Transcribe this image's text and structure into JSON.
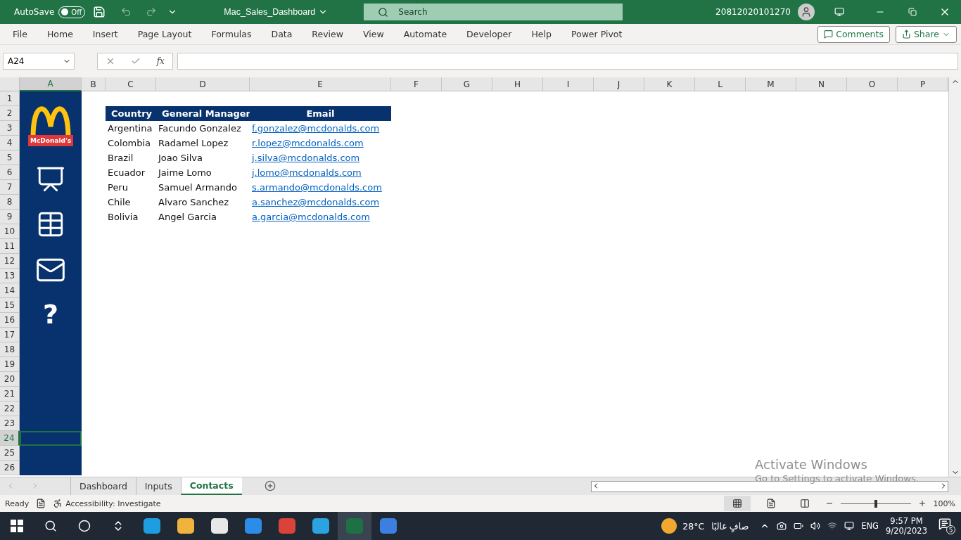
{
  "title_bar": {
    "autosave_label": "AutoSave",
    "autosave_state": "Off",
    "autosave_on": false,
    "document_title": "Mac_Sales_Dashboard",
    "search_placeholder": "Search",
    "user": "20812020101270"
  },
  "ribbon_tabs": [
    "File",
    "Home",
    "Insert",
    "Page Layout",
    "Formulas",
    "Data",
    "Review",
    "View",
    "Automate",
    "Developer",
    "Help",
    "Power Pivot"
  ],
  "comments_button": "Comments",
  "share_button": "Share",
  "formula_bar": {
    "name_box": "A24",
    "function_label": "fx"
  },
  "columns": [
    {
      "label": "A",
      "selected": true
    },
    {
      "label": "B",
      "selected": false
    },
    {
      "label": "C",
      "selected": false
    },
    {
      "label": "D",
      "selected": false
    },
    {
      "label": "E",
      "selected": false
    },
    {
      "label": "F",
      "selected": false
    },
    {
      "label": "G",
      "selected": false
    },
    {
      "label": "H",
      "selected": false
    },
    {
      "label": "I",
      "selected": false
    },
    {
      "label": "J",
      "selected": false
    },
    {
      "label": "K",
      "selected": false
    },
    {
      "label": "L",
      "selected": false
    },
    {
      "label": "M",
      "selected": false
    },
    {
      "label": "N",
      "selected": false
    },
    {
      "label": "O",
      "selected": false
    },
    {
      "label": "P",
      "selected": false
    }
  ],
  "rows": [
    {
      "label": "1",
      "selected": false
    },
    {
      "label": "2",
      "selected": false
    },
    {
      "label": "3",
      "selected": false
    },
    {
      "label": "4",
      "selected": false
    },
    {
      "label": "5",
      "selected": false
    },
    {
      "label": "6",
      "selected": false
    },
    {
      "label": "7",
      "selected": false
    },
    {
      "label": "8",
      "selected": false
    },
    {
      "label": "9",
      "selected": false
    },
    {
      "label": "10",
      "selected": false
    },
    {
      "label": "11",
      "selected": false
    },
    {
      "label": "12",
      "selected": false
    },
    {
      "label": "13",
      "selected": false
    },
    {
      "label": "14",
      "selected": false
    },
    {
      "label": "15",
      "selected": false
    },
    {
      "label": "16",
      "selected": false
    },
    {
      "label": "17",
      "selected": false
    },
    {
      "label": "18",
      "selected": false
    },
    {
      "label": "19",
      "selected": false
    },
    {
      "label": "20",
      "selected": false
    },
    {
      "label": "21",
      "selected": false
    },
    {
      "label": "22",
      "selected": false
    },
    {
      "label": "23",
      "selected": false
    },
    {
      "label": "24",
      "selected": true
    },
    {
      "label": "25",
      "selected": false
    },
    {
      "label": "26",
      "selected": false
    }
  ],
  "sidebar": {
    "logo_text": "McDonald's",
    "help_glyph": "?"
  },
  "table": {
    "columns": [
      "Country",
      "General Manager",
      "Email"
    ],
    "rows": [
      [
        "Argentina",
        "Facundo Gonzalez",
        "f.gonzalez@mcdonalds.com"
      ],
      [
        "Colombia",
        "Radamel Lopez",
        "r.lopez@mcdonalds.com"
      ],
      [
        "Brazil",
        "Joao Silva",
        "j.silva@mcdonalds.com"
      ],
      [
        "Ecuador",
        "Jaime Lomo",
        "j.lomo@mcdonalds.com"
      ],
      [
        "Peru",
        "Samuel Armando",
        "s.armando@mcdonalds.com"
      ],
      [
        "Chile",
        "Alvaro Sanchez",
        "a.sanchez@mcdonalds.com"
      ],
      [
        "Bolivia",
        "Angel Garcia",
        "a.garcia@mcdonalds.com"
      ]
    ]
  },
  "activation_notice": {
    "title": "Activate Windows",
    "subtitle": "Go to Settings to activate Windows."
  },
  "sheet_tabs": [
    {
      "label": "Dashboard",
      "selected": false
    },
    {
      "label": "Inputs",
      "selected": false
    },
    {
      "label": "Contacts",
      "selected": true
    }
  ],
  "status_bar": {
    "ready": "Ready",
    "accessibility": "Accessibility: Investigate",
    "zoom": "100%",
    "zoom_slider": {
      "level": 0.5
    }
  },
  "taskbar": {
    "temperature": "28°C",
    "weather_text": "صافٍ غالبًا",
    "language": "ENG",
    "time": "9:57 PM",
    "date": "9/20/2023",
    "notification_count": "5"
  }
}
